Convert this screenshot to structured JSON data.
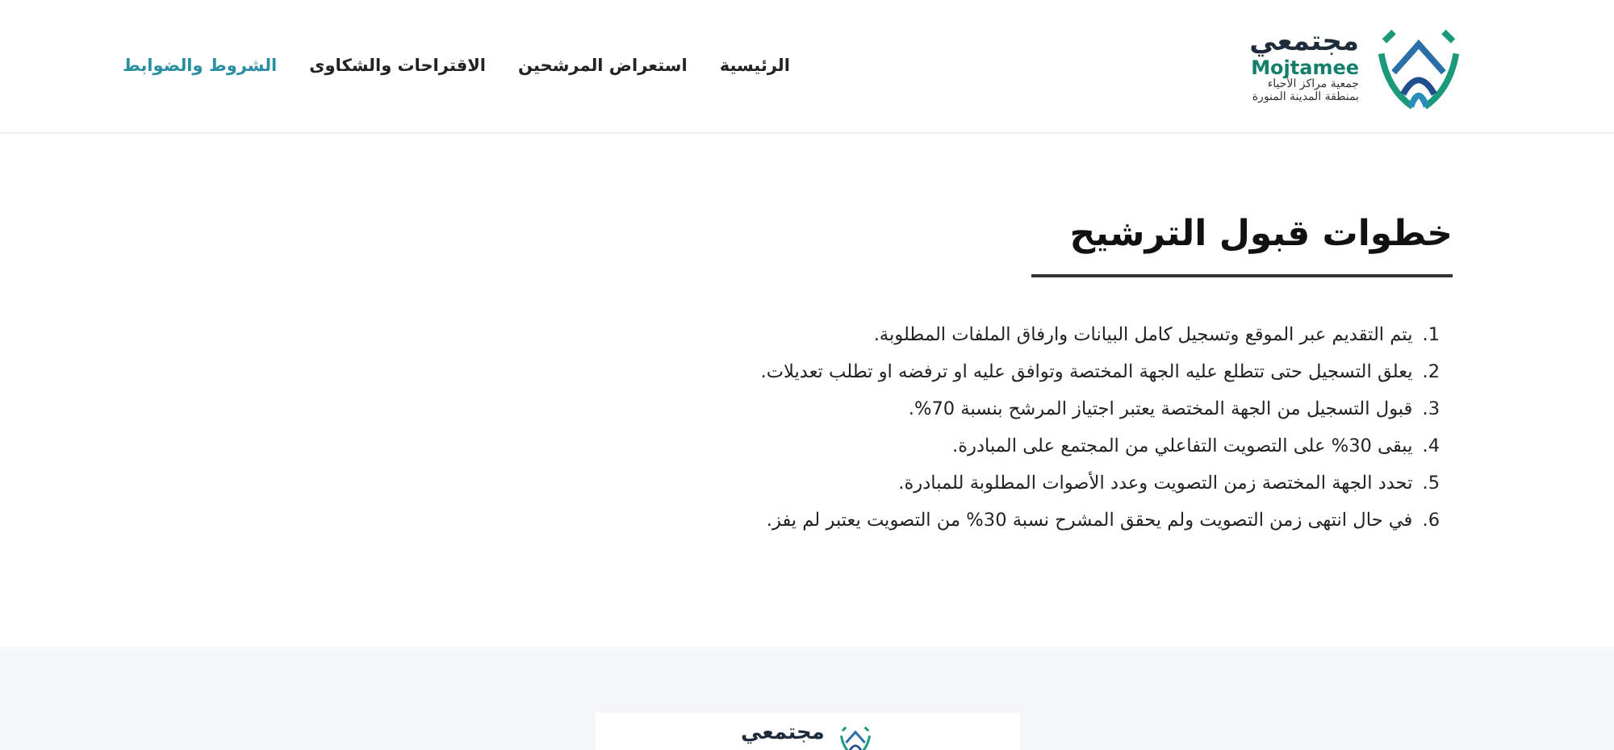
{
  "header": {
    "logo": {
      "name_ar": "مجتمعي",
      "name_en": "Mojtamee",
      "subtitle_1": "جمعية مراكز الأحياء",
      "subtitle_2": "بمنطقة المدينة المنورة"
    },
    "nav": [
      {
        "label": "الرئيسية",
        "selected": false
      },
      {
        "label": "استعراض المرشحين",
        "selected": false
      },
      {
        "label": "الاقتراحات والشكاوى",
        "selected": false
      },
      {
        "label": "الشروط والضوابط",
        "selected": true
      }
    ]
  },
  "content": {
    "title": "خطوات قبول الترشيح",
    "steps": [
      {
        "number": "1.",
        "text": "يتم التقديم عبر الموقع وتسجيل كامل البيانات وارفاق الملفات المطلوبة."
      },
      {
        "number": "2.",
        "text": "يعلق التسجيل حتى تتطلع عليه الجهة المختصة وتوافق عليه او ترفضه او تطلب تعديلات."
      },
      {
        "number": "3.",
        "text": "قبول التسجيل من الجهة المختصة يعتبر اجتياز المرشح بنسبة 70%."
      },
      {
        "number": "4.",
        "text": "يبقى 30% على التصويت التفاعلي من المجتمع على المبادرة."
      },
      {
        "number": "5.",
        "text": "تحدد الجهة المختصة زمن التصويت وعدد الأصوات المطلوبة للمبادرة."
      },
      {
        "number": "6.",
        "text": "في حال انتهى زمن التصويت ولم يحقق المشرح نسبة 30% من التصويت يعتبر لم يفز."
      }
    ]
  },
  "footer": {
    "logo_name": "مجتمعي"
  }
}
